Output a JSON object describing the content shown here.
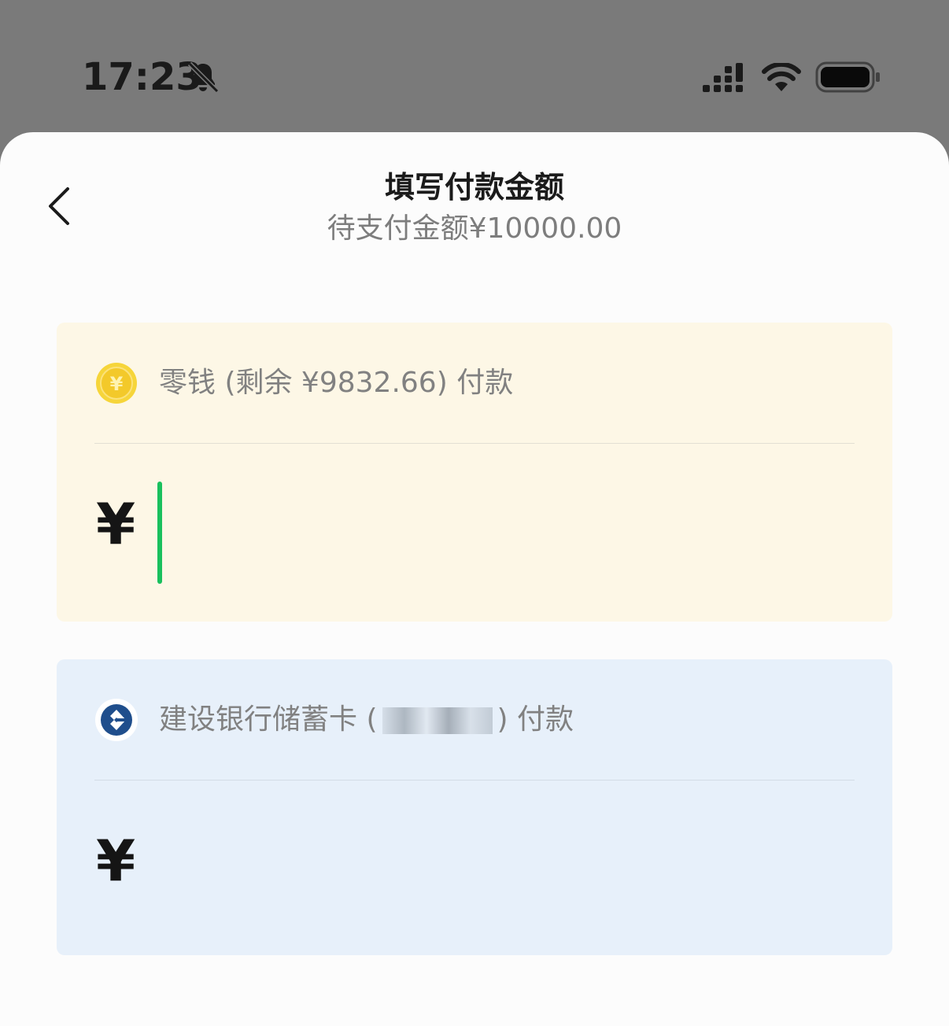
{
  "status_bar": {
    "time": "17:23",
    "icons": [
      "bell-slash-icon",
      "cellular-signal-icon",
      "wifi-icon",
      "battery-icon"
    ]
  },
  "header": {
    "title": "填写付款金额",
    "subtitle": "待支付金额¥10000.00",
    "back_icon": "chevron-left-icon"
  },
  "cards": [
    {
      "label": "零钱 (剩余 ¥9832.66) 付款",
      "icon": "coin-icon",
      "currency_symbol": "¥",
      "amount_value": "",
      "focused": true,
      "background": "#fdf7e6"
    },
    {
      "label_prefix": "建设银行储蓄卡 (",
      "label_suffix": ") 付款",
      "icon": "ccb-bank-icon",
      "currency_symbol": "¥",
      "amount_value": "",
      "focused": false,
      "background": "#e7f0fa"
    }
  ],
  "colors": {
    "caret": "#19c05d",
    "coin": "#f6d53a"
  }
}
